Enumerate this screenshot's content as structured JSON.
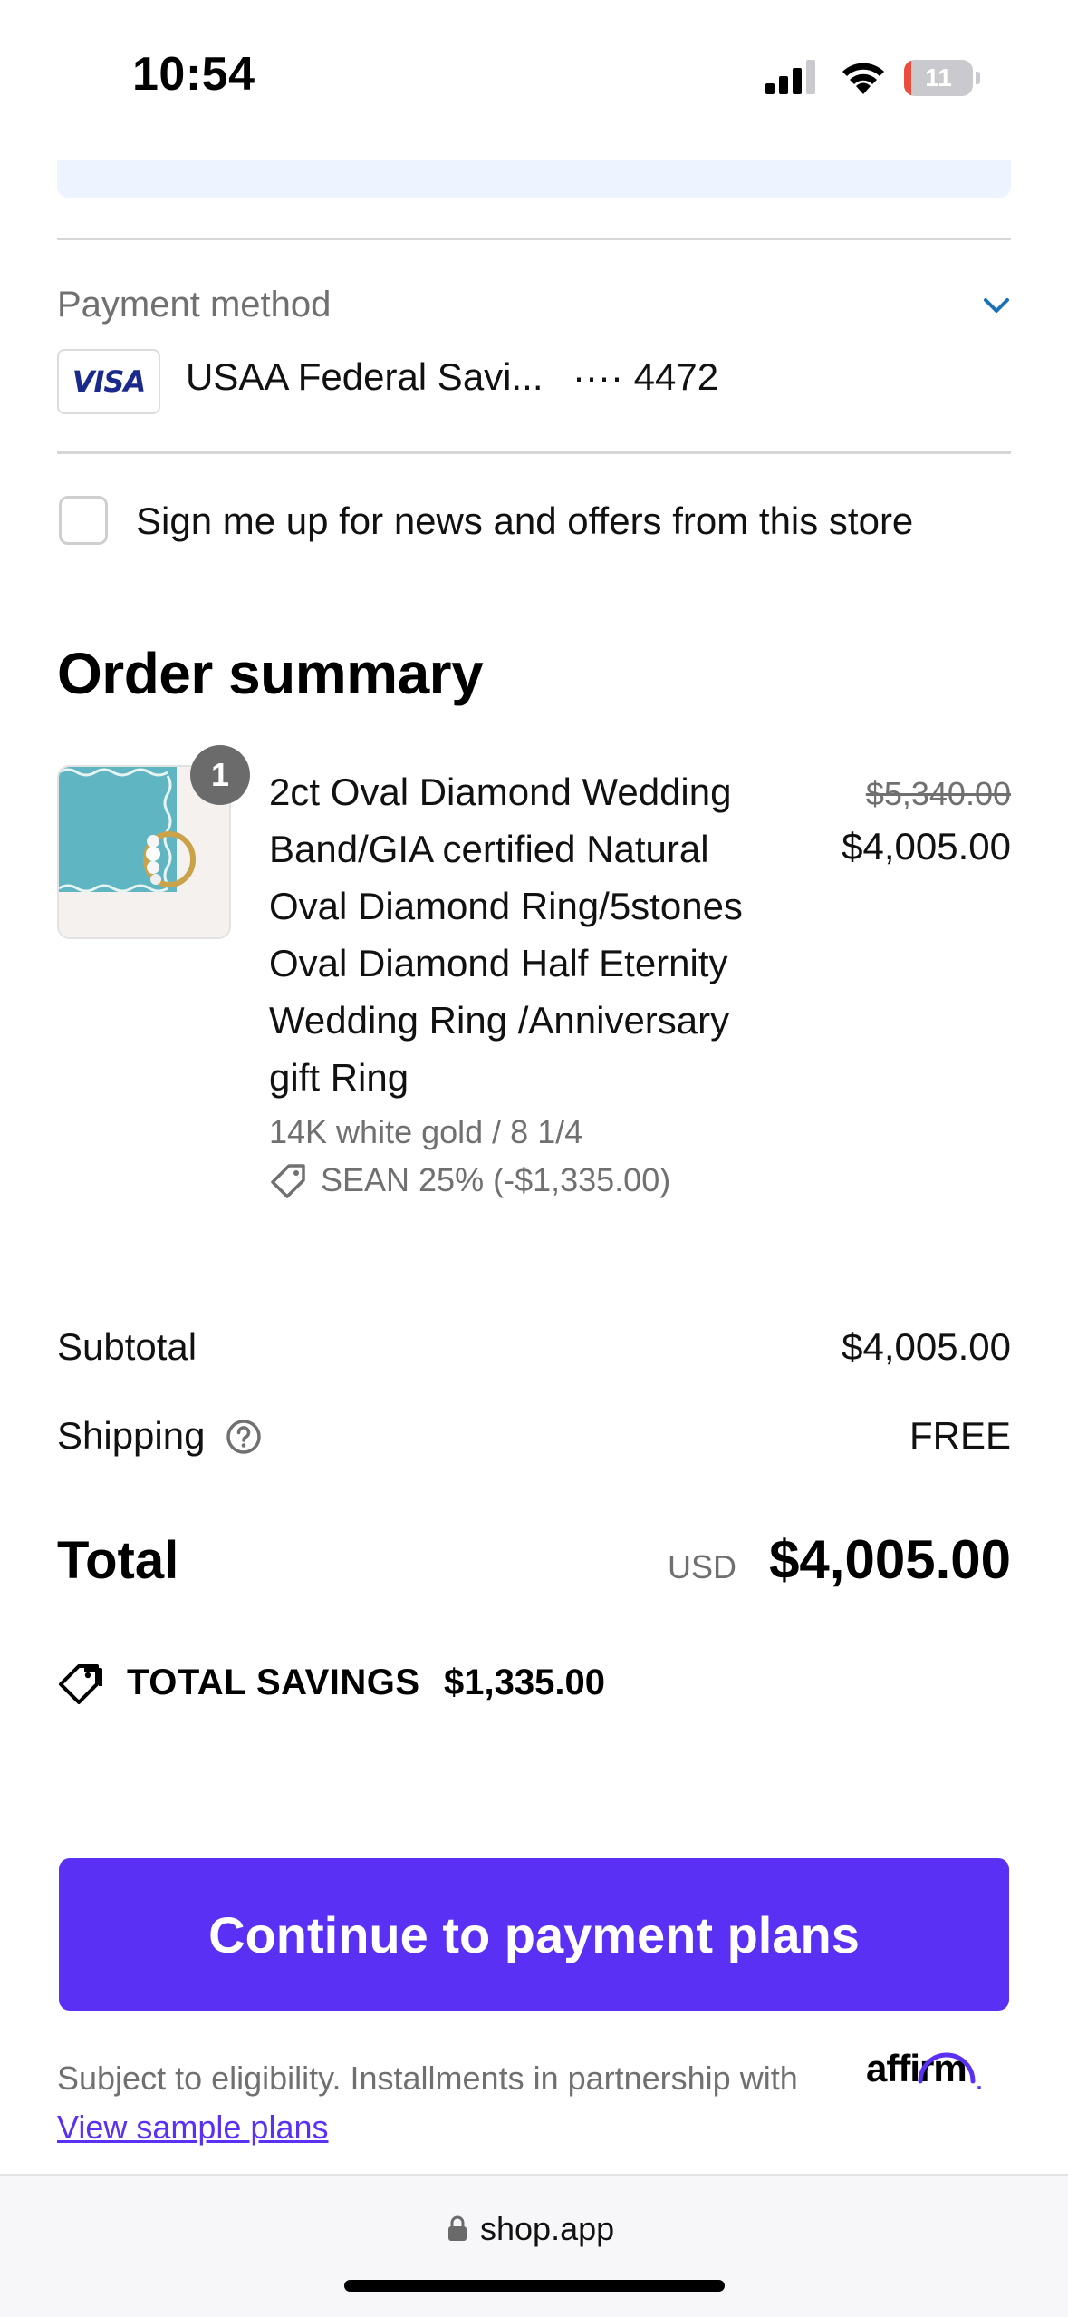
{
  "status_bar": {
    "time": "10:54",
    "battery_level": "11",
    "battery_fraction": 0.11
  },
  "payment": {
    "label": "Payment method",
    "card_brand": "VISA",
    "bank_name": "USAA Federal Savi...",
    "card_last4": "···· 4472"
  },
  "newsletter": {
    "label": "Sign me up for news and offers from this store",
    "checked": false
  },
  "order_summary": {
    "title": "Order summary",
    "item": {
      "quantity": "1",
      "name": "2ct Oval Diamond Wedding Band/GIA certified Natural Oval Diamond Ring/5stones Oval Diamond Half Eternity Wedding Ring /Anniversary gift Ring",
      "variant": "14K white gold / 8 1/4",
      "discount": "SEAN 25% (-$1,335.00)",
      "original_price": "$5,340.00",
      "price": "$4,005.00"
    },
    "subtotal_label": "Subtotal",
    "subtotal_value": "$4,005.00",
    "shipping_label": "Shipping",
    "shipping_value": "FREE",
    "total_label": "Total",
    "total_currency": "USD",
    "total_value": "$4,005.00",
    "savings_label": "TOTAL SAVINGS",
    "savings_value": "$1,335.00"
  },
  "cta": {
    "label": "Continue to payment plans"
  },
  "fineprint": {
    "text": "Subject to eligibility. Installments in partnership with",
    "partner_logo": "affirm",
    "trailing": ".",
    "link": "View sample plans"
  },
  "browser": {
    "url": "shop.app"
  },
  "colors": {
    "accent": "#5a31f4",
    "battery_low": "#eb4d3d",
    "chevron": "#1a73b8"
  }
}
